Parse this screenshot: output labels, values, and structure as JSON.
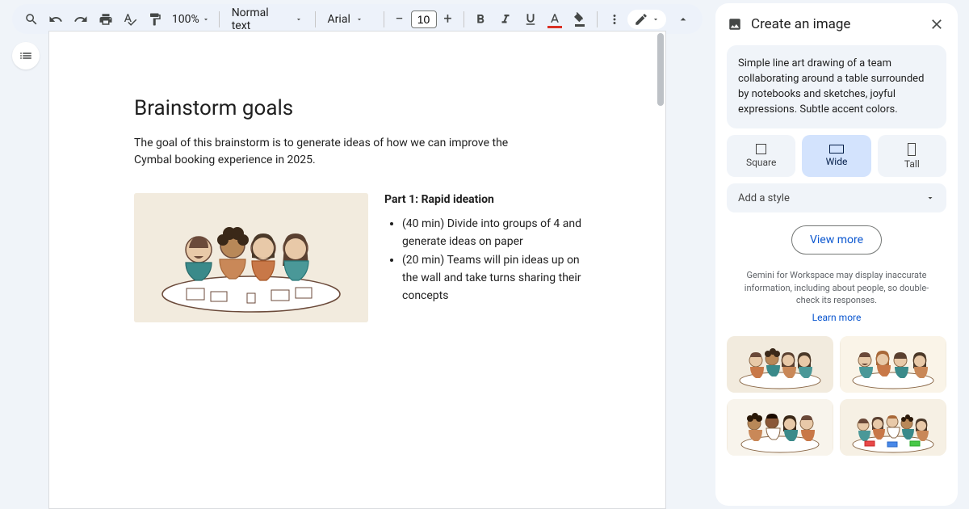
{
  "toolbar": {
    "zoom": "100%",
    "style": "Normal text",
    "font": "Arial",
    "font_size": "10"
  },
  "document": {
    "title": "Brainstorm goals",
    "intro": "The goal of this brainstorm is to generate ideas of how we can improve the Cymbal booking experience in 2025.",
    "part_title": "Part 1: Rapid ideation",
    "bullets": [
      "(40 min) Divide into groups of 4 and generate ideas on paper",
      "(20 min) Teams will pin ideas up on the wall and take turns sharing their concepts"
    ]
  },
  "panel": {
    "title": "Create an image",
    "prompt": "Simple line art drawing of a team collaborating around a table surrounded by notebooks and sketches, joyful expressions. Subtle accent colors.",
    "aspects": {
      "square": "Square",
      "wide": "Wide",
      "tall": "Tall"
    },
    "style_placeholder": "Add a style",
    "view_more": "View more",
    "disclaimer": "Gemini for Workspace may display inaccurate information, including about people, so double-check its responses.",
    "learn_more": "Learn more"
  }
}
